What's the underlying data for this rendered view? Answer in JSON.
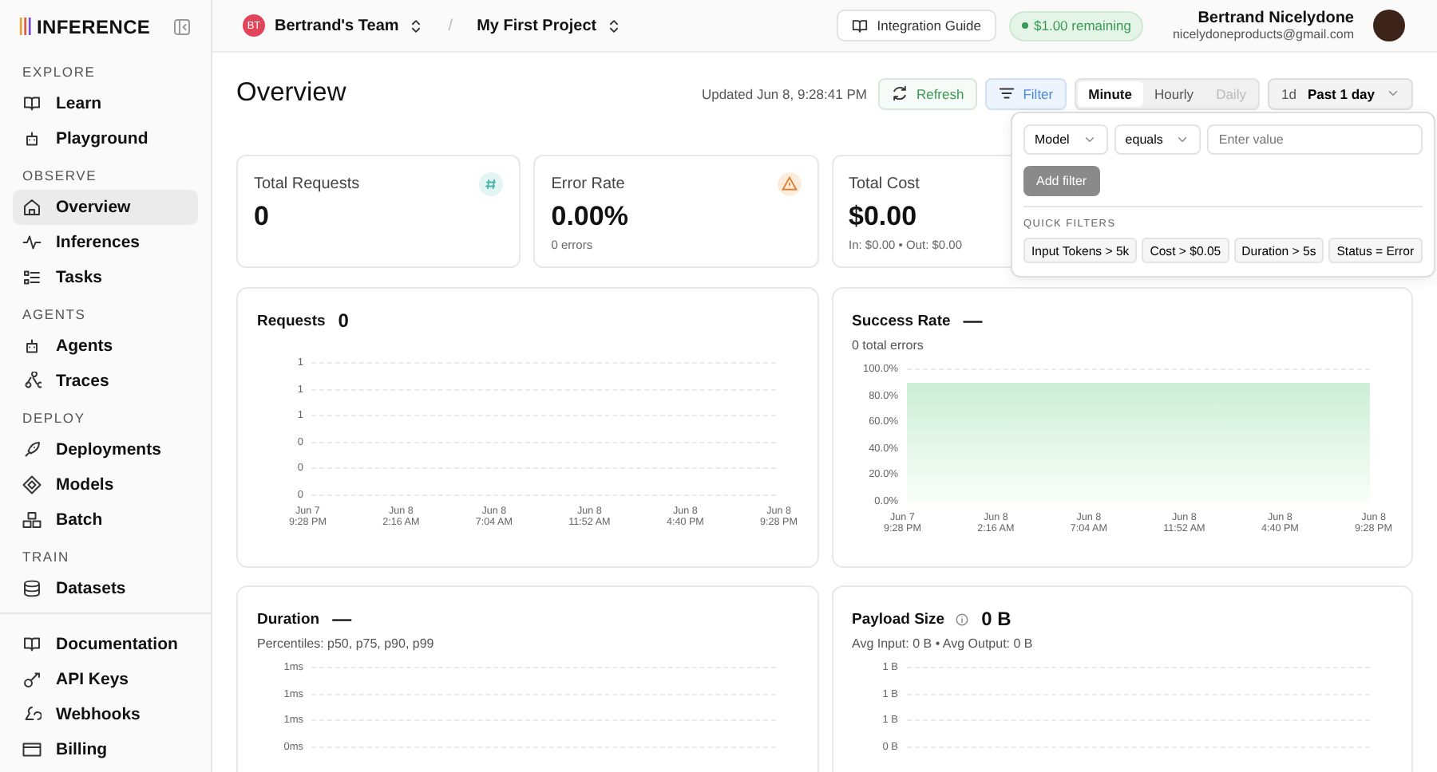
{
  "logo": "INFERENCE",
  "sidebar": {
    "sections": [
      {
        "heading": "EXPLORE",
        "items": [
          {
            "label": "Learn",
            "selected": false
          },
          {
            "label": "Playground",
            "selected": false
          }
        ]
      },
      {
        "heading": "OBSERVE",
        "items": [
          {
            "label": "Overview",
            "selected": true
          },
          {
            "label": "Inferences",
            "selected": false
          },
          {
            "label": "Tasks",
            "selected": false
          }
        ]
      },
      {
        "heading": "AGENTS",
        "items": [
          {
            "label": "Agents",
            "selected": false
          },
          {
            "label": "Traces",
            "selected": false
          }
        ]
      },
      {
        "heading": "DEPLOY",
        "items": [
          {
            "label": "Deployments",
            "selected": false
          },
          {
            "label": "Models",
            "selected": false
          },
          {
            "label": "Batch",
            "selected": false
          }
        ]
      },
      {
        "heading": "TRAIN",
        "items": [
          {
            "label": "Datasets",
            "selected": false
          }
        ]
      }
    ],
    "footer_items": [
      {
        "label": "Documentation",
        "selected": false
      },
      {
        "label": "API Keys",
        "selected": false
      },
      {
        "label": "Webhooks",
        "selected": false
      },
      {
        "label": "Billing",
        "selected": false
      }
    ]
  },
  "header": {
    "team_initials": "BT",
    "team": "Bertrand's Team",
    "separator": "/",
    "project": "My First Project",
    "guide": "Integration Guide",
    "credit": "$1.00 remaining",
    "user_name": "Bertrand Nicelydone",
    "user_email": "nicelydoneproducts@gmail.com"
  },
  "page": {
    "title": "Overview",
    "updated": "Updated Jun 8, 9:28:41 PM",
    "refresh": "Refresh",
    "filter": {
      "label": "Filter",
      "open": true
    },
    "granularity": [
      {
        "label": "Minute",
        "selected": true,
        "disabled": false
      },
      {
        "label": "Hourly",
        "selected": false,
        "disabled": false
      },
      {
        "label": "Daily",
        "selected": false,
        "disabled": true
      }
    ],
    "range": {
      "short": "1d",
      "label": "Past 1 day"
    }
  },
  "stats": [
    {
      "kind": "count",
      "title": "Total Requests",
      "value": "0"
    },
    {
      "kind": "warning",
      "title": "Error Rate",
      "value": "0.00%",
      "note": "0 errors"
    },
    {
      "kind": "plain",
      "title": "Total Cost",
      "value": "$0.00",
      "note": "In: $0.00 • Out: $0.00"
    }
  ],
  "filter_popover": {
    "field": "Model",
    "operator": "equals",
    "placeholder": "Enter value",
    "add": "Add filter",
    "quick_heading": "QUICK FILTERS",
    "quick": [
      "Input Tokens > 5k",
      "Cost > $0.05",
      "Duration > 5s",
      "Status = Error"
    ]
  },
  "charts": [
    {
      "kind": "grid",
      "title": "Requests",
      "value": "0",
      "info": false,
      "y_ticks": [
        "1",
        "1",
        "1",
        "0",
        "0",
        "0"
      ],
      "x_ticks": [
        [
          "Jun 7",
          "9:28 PM"
        ],
        [
          "Jun 8",
          "2:16 AM"
        ],
        [
          "Jun 8",
          "7:04 AM"
        ],
        [
          "Jun 8",
          "11:52 AM"
        ],
        [
          "Jun 8",
          "4:40 PM"
        ],
        [
          "Jun 8",
          "9:28 PM"
        ]
      ]
    },
    {
      "kind": "area",
      "title": "Success Rate",
      "value": "—",
      "info": false,
      "subtitle": "0 total errors",
      "y_ticks": [
        "100.0%",
        "80.0%",
        "60.0%",
        "40.0%",
        "20.0%",
        "0.0%"
      ],
      "x_ticks": [
        [
          "Jun 7",
          "9:28 PM"
        ],
        [
          "Jun 8",
          "2:16 AM"
        ],
        [
          "Jun 8",
          "7:04 AM"
        ],
        [
          "Jun 8",
          "11:52 AM"
        ],
        [
          "Jun 8",
          "4:40 PM"
        ],
        [
          "Jun 8",
          "9:28 PM"
        ]
      ]
    },
    {
      "kind": "grid",
      "title": "Duration",
      "value": "—",
      "info": false,
      "subtitle": "Percentiles: p50, p75, p90, p99",
      "y_ticks": [
        "1ms",
        "1ms",
        "1ms",
        "0ms"
      ]
    },
    {
      "kind": "grid",
      "title": "Payload Size",
      "value": "0 B",
      "info": true,
      "subtitle": "Avg Input: 0 B • Avg Output: 0 B",
      "y_ticks": [
        "1 B",
        "1 B",
        "1 B",
        "0 B"
      ]
    }
  ]
}
